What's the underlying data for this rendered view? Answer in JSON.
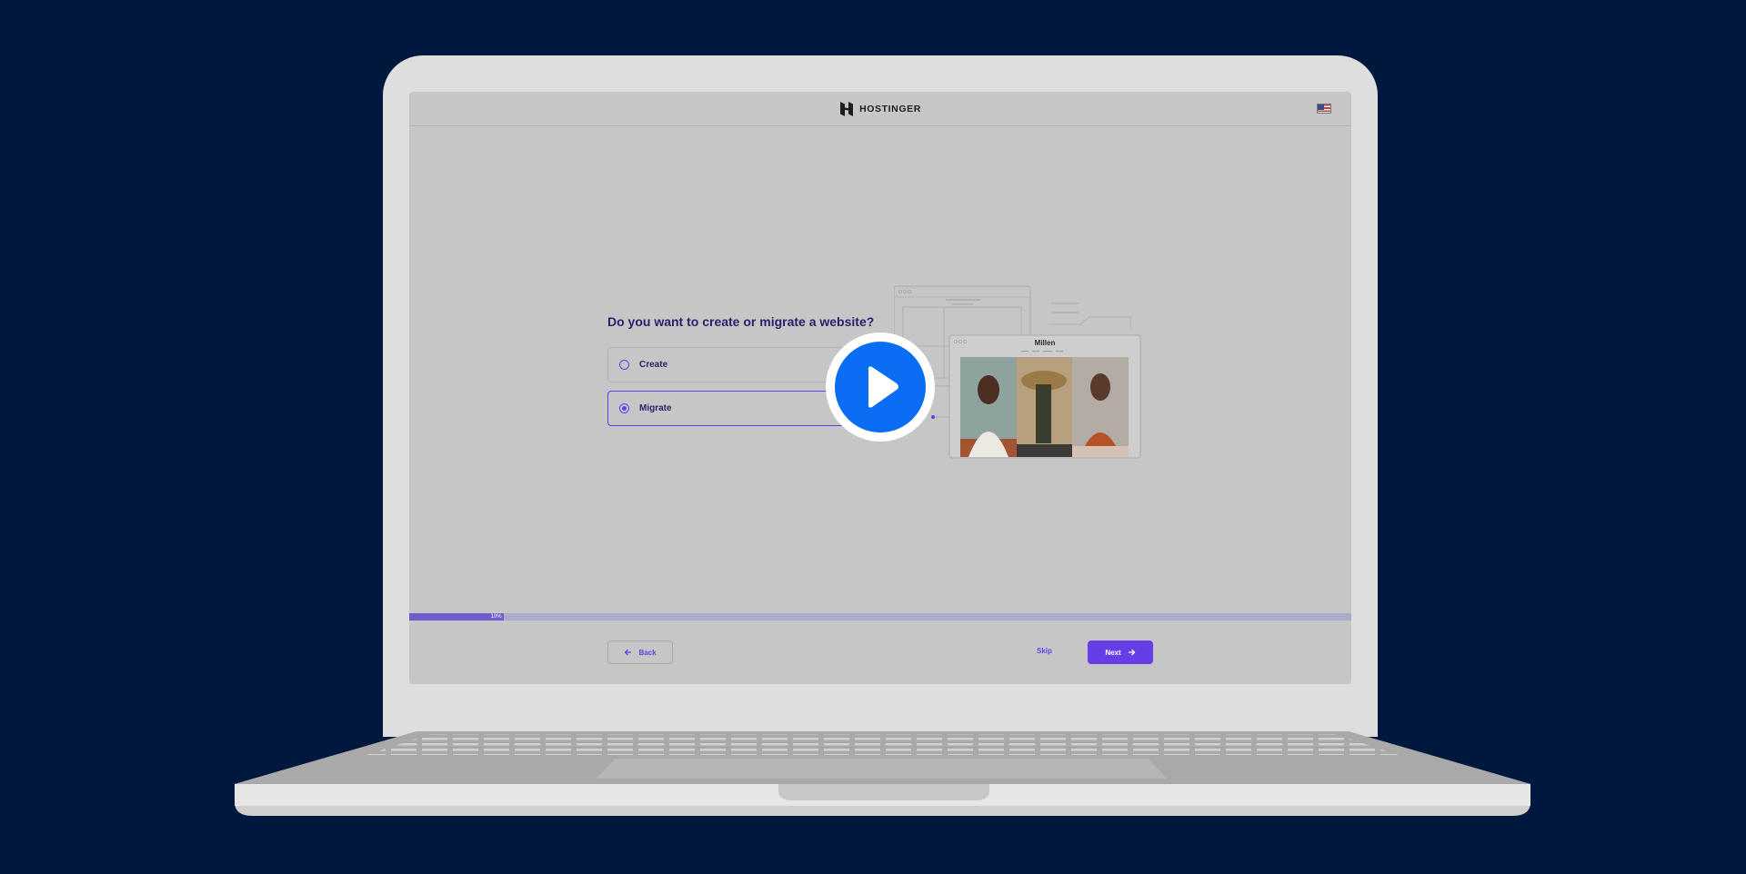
{
  "header": {
    "brand": "HOSTINGER",
    "language_flag": "us-flag-icon"
  },
  "question": "Do you want to create or migrate a website?",
  "options": [
    {
      "label": "Create",
      "selected": false
    },
    {
      "label": "Migrate",
      "selected": true
    }
  ],
  "illustration": {
    "site_name": "Millen"
  },
  "progress": {
    "value": 0.1,
    "label": "10%"
  },
  "footer": {
    "back_label": "Back",
    "skip_label": "Skip",
    "next_label": "Next"
  },
  "video": {
    "play_icon": "play-icon"
  },
  "colors": {
    "background": "#00183d",
    "accent": "#673de6",
    "play": "#0b6cf4"
  }
}
